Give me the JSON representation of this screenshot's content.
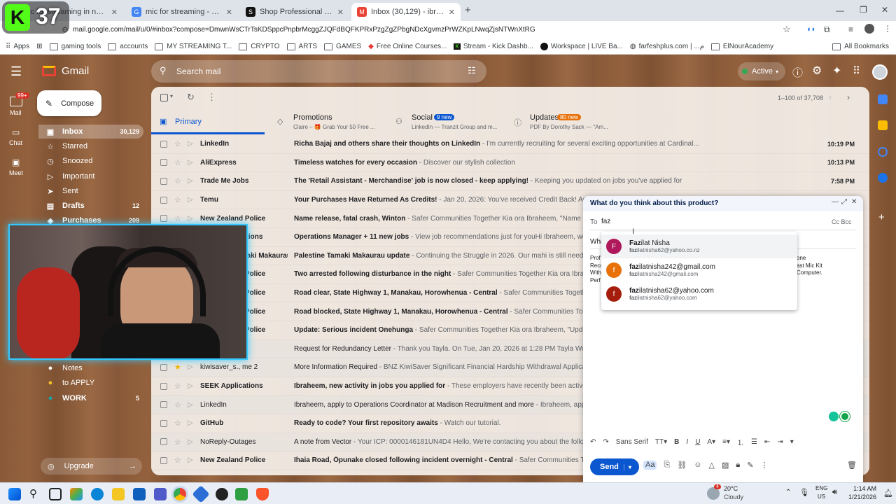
{
  "browser": {
    "tabs": [
      {
        "title": "mic for streaming in nz - Goo",
        "fav": "G",
        "color": "#4285f4"
      },
      {
        "title": "mic for streaming - Google Sea",
        "fav": "G",
        "color": "#4285f4"
      },
      {
        "title": "Shop Professional Podcast Equ",
        "fav": "S",
        "color": "#111111"
      },
      {
        "title": "Inbox (30,129) - ibraheemkhud",
        "fav": "M",
        "color": "#ea4335"
      }
    ],
    "new_tab": "+",
    "url": "mail.google.com/mail/u/0/#inbox?compose=DmwnWsCTrTsKDSppcPnpbrMcggZJQFdBQFKPRxPzgZgZPbgNDcXgvmzPrWZKpLNwqZjsNTWnXtRG",
    "bookmarks": [
      "Apps",
      "gaming tools",
      "accounts",
      "MY STREAMING T...",
      "CRYPTO",
      "ARTS",
      "GAMES",
      "Free Online Courses...",
      "Stream - Kick Dashb...",
      "Workspace | LIVE Ba...",
      "farfeshplus.com | ...م",
      "ElNourAcademy"
    ],
    "all_bookmarks": "All Bookmarks"
  },
  "overlay_badge": "37",
  "gmail": {
    "brand": "Gmail",
    "search_placeholder": "Search mail",
    "status": "Active",
    "compose_label": "Compose",
    "rail": [
      {
        "label": "Mail",
        "badge": "99+"
      },
      {
        "label": "Chat"
      },
      {
        "label": "Meet"
      }
    ],
    "nav": [
      {
        "label": "Inbox",
        "count": "30,129",
        "icon": "inbox-icon"
      },
      {
        "label": "Starred",
        "count": "",
        "icon": "star-icon"
      },
      {
        "label": "Snoozed",
        "count": "",
        "icon": "clock-icon"
      },
      {
        "label": "Important",
        "count": "",
        "icon": "important-icon"
      },
      {
        "label": "Sent",
        "count": "",
        "icon": "send-icon"
      },
      {
        "label": "Drafts",
        "count": "12",
        "icon": "draft-icon"
      },
      {
        "label": "Purchases",
        "count": "209",
        "icon": "tag-icon"
      }
    ],
    "labels": [
      {
        "label": "Notes",
        "count": "",
        "color": "#ffffff"
      },
      {
        "label": "to APPLY",
        "count": "",
        "color": "#f6bf26"
      },
      {
        "label": "WORK",
        "count": "5",
        "color": "#16a5a5"
      }
    ],
    "upgrade": "Upgrade",
    "pagination": "1–100 of 37,708",
    "tabs": [
      {
        "label": "Primary",
        "snippet": "",
        "badge": ""
      },
      {
        "label": "Promotions",
        "snippet": "Claire – 🎁 Grab Your 50 Free ...",
        "badge": ""
      },
      {
        "label": "Social",
        "snippet": "LinkedIn — Tranzit Group and m...",
        "badge": "9 new"
      },
      {
        "label": "Updates",
        "snippet": "PDF By Dorothy Sack — \"Am...",
        "badge": "80 new"
      }
    ],
    "emails": [
      {
        "sender": "LinkedIn",
        "subject": "Richa Bajaj and others share their thoughts on LinkedIn",
        "snippet": " - I'm currently recruiting for several exciting opportunities at Cardinal...",
        "time": "10:19 PM",
        "unread": true
      },
      {
        "sender": "AliExpress",
        "subject": "Timeless watches for every occasion",
        "snippet": " - Discover our stylish collection",
        "time": "10:13 PM",
        "unread": true
      },
      {
        "sender": "Trade Me Jobs",
        "subject": "The 'Retail Assistant - Merchandise' job is now closed - keep applying!",
        "snippet": " - Keeping you updated on jobs you've applied for",
        "time": "7:58 PM",
        "unread": true
      },
      {
        "sender": "Temu",
        "subject": "Your Purchases Have Returned As Credits!",
        "snippet": " - Jan 20, 2026: You've received Credit Back! Accept",
        "time": "",
        "unread": true
      },
      {
        "sender": "New Zealand Police",
        "subject": "Name release, fatal crash, Winton",
        "snippet": " - Safer Communities Together Kia ora Ibraheem, \"Name relea",
        "time": "",
        "unread": true
      },
      {
        "sender": "Recommendations",
        "subject": "Operations Manager + 11 new jobs",
        "snippet": " - View job recommendations just for youHi Ibraheem, we've g",
        "time": "",
        "unread": true
      },
      {
        "sender": "Palestine Tamaki Makaurau",
        "subject": "Palestine Tamaki Makaurau update",
        "snippet": " - Continuing the Struggle in 2026. Our mahi is still needed. ...",
        "time": "",
        "unread": true
      },
      {
        "sender": "New Zealand Police",
        "subject": "Two arrested following disturbance in the night",
        "snippet": " - Safer Communities Together Kia ora Ibraheem",
        "time": "",
        "unread": true
      },
      {
        "sender": "New Zealand Police",
        "subject": "Road clear, State Highway 1, Manakau, Horowhenua - Central",
        "snippet": " - Safer Communities Together K",
        "time": "",
        "unread": true
      },
      {
        "sender": "New Zealand Police",
        "subject": "Road blocked, State Highway 1, Manakau, Horowhenua - Central",
        "snippet": " - Safer Communities Togethe",
        "time": "",
        "unread": true
      },
      {
        "sender": "New Zealand Police",
        "subject": "Update: Serious incident Onehunga",
        "snippet": " - Safer Communities Together Kia ora Ibraheem, \"Update: S",
        "time": "",
        "unread": true
      },
      {
        "sender": "Tayla Woolley",
        "subject": "Request for Redundancy Letter",
        "snippet": " - Thank you Tayla. On Tue, Jan 20, 2026 at 1:28 PM Tayla Woolley <",
        "time": "",
        "unread": false
      },
      {
        "sender": "kiwisaver_s., me 2",
        "subject": "More Information Required",
        "snippet": " - BNZ KiwiSaver Significant Financial Hardship Withdrawal Application",
        "time": "",
        "unread": false,
        "starred": true
      },
      {
        "sender": "SEEK Applications",
        "subject": "Ibraheem, new activity in jobs you applied for",
        "snippet": " - These employers have recently been active in j",
        "time": "",
        "unread": true
      },
      {
        "sender": "LinkedIn",
        "subject": "Ibraheem, apply to Operations Coordinator at Madison Recruitment and more",
        "snippet": " - Ibraheem, apply to",
        "time": "",
        "unread": false
      },
      {
        "sender": "GitHub",
        "subject": "Ready to code? Your first repository awaits",
        "snippet": " - Watch our tutorial.",
        "time": "",
        "unread": true
      },
      {
        "sender": "NoReply-Outages",
        "subject": "A note from Vector",
        "snippet": " - Your ICP: 0000146181UN4D4 Hello, We're contacting you about the following",
        "time": "",
        "unread": false
      },
      {
        "sender": "New Zealand Police",
        "subject": "Ihaia Road, Ōpunake closed following incident overnight - Central",
        "snippet": " - Safer Communities Togethe",
        "time": "",
        "unread": true
      }
    ],
    "compose": {
      "title": "What do you think about this product?",
      "to_label": "To",
      "to_value": "faz",
      "cc_bcc": "Cc Bcc",
      "subject_partial": "Wha",
      "body_left": [
        "Prof",
        "Reco",
        "With",
        "Perf"
      ],
      "body_right": [
        "one",
        "ast Mic Kit",
        "Computer."
      ],
      "font_name": "Sans Serif",
      "send": "Send",
      "suggestions": [
        {
          "initial": "F",
          "name_bold": "Faz",
          "name_rest": "ilat Nisha",
          "email_bold": "faz",
          "email_rest": "ilatnisha62@yahoo.co.nz",
          "color": "#b0185c"
        },
        {
          "initial": "f",
          "name_bold": "faz",
          "name_rest": "ilatnisha242@gmail.com",
          "email_bold": "faz",
          "email_rest": "ilatnisha242@gmail.com",
          "color": "#e8710a"
        },
        {
          "initial": "f",
          "name_bold": "faz",
          "name_rest": "ilatnisha62@yahoo.com",
          "email_bold": "faz",
          "email_rest": "ilatnisha62@yahoo.com",
          "color": "#a51d0d"
        }
      ]
    }
  },
  "taskbar": {
    "weather_temp": "20°C",
    "weather_desc": "Cloudy",
    "weather_badge": "4",
    "lang": "ENG",
    "region": "US",
    "time": "1:14 AM",
    "date": "1/21/2026"
  }
}
